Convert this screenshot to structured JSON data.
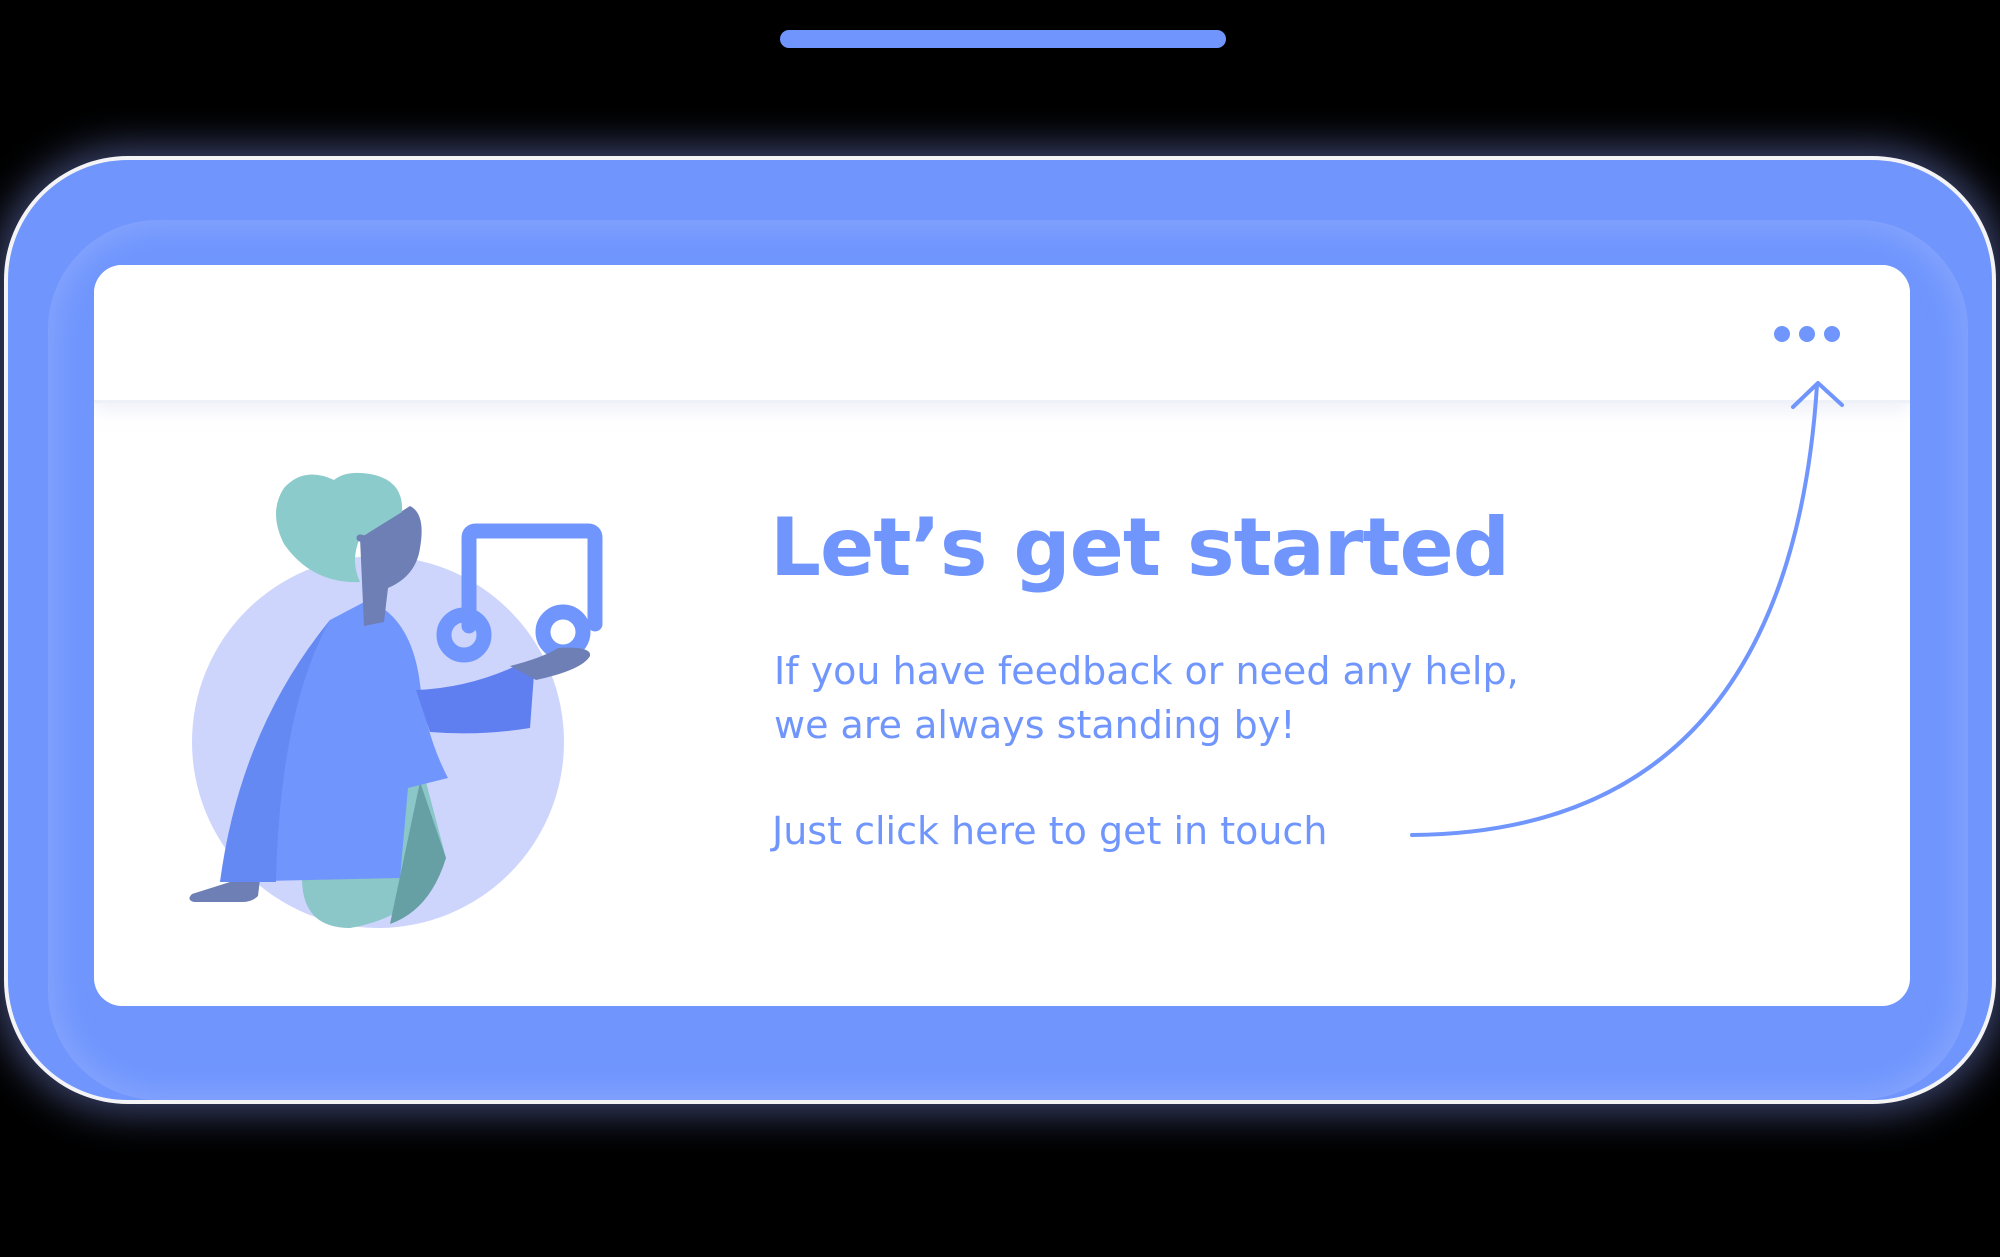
{
  "colors": {
    "accent": "#7096fd",
    "card_background": "#ffffff",
    "backdrop": "#000000",
    "illustration_circle": "#ced5fd",
    "illustration_hair": "#8ccbcb",
    "illustration_skin": "#6d7fb5",
    "illustration_pants": "#8bc6c9",
    "illustration_pants_shadow": "#669fa4"
  },
  "illustration": {
    "icon": "music-note-icon",
    "subject": "person-holding-music-note"
  },
  "header": {
    "menu_icon": "more-horizontal-icon"
  },
  "content": {
    "title": "Let’s get started",
    "subtitle_line1": "If you have feedback or need any help,",
    "subtitle_line2": "we are always standing by!",
    "link_text": "Just click here to get in touch"
  },
  "pointer": {
    "icon": "curved-arrow-up-icon"
  }
}
